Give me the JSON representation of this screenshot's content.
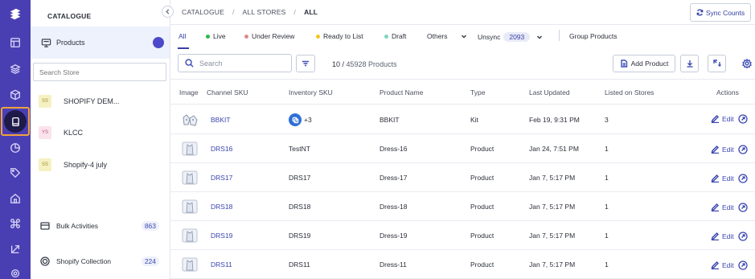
{
  "sidebar_rail": {
    "icons": [
      "logo-icon",
      "dashboard-icon",
      "layers-icon",
      "box-icon",
      "catalogue-icon",
      "analytics-icon",
      "tag-icon",
      "home-icon",
      "command-icon",
      "arrow-icon",
      "settings-icon"
    ],
    "accent": "#4a3fb2",
    "highlight": "#f0a23c"
  },
  "catalogue_panel": {
    "title": "CATALOGUE",
    "products_label": "Products",
    "search_placeholder": "Search Store",
    "stores": [
      {
        "badge": "SS",
        "name": "SHOPIFY DEM...",
        "badge_bg": "#f6f1c2",
        "badge_color": "#9c8f2a"
      },
      {
        "badge": "YS",
        "name": "KLCC",
        "badge_bg": "#fbe3ec",
        "badge_color": "#b25a7c"
      },
      {
        "badge": "SS",
        "name": "Shopify-4 july",
        "badge_bg": "#f6f1c2",
        "badge_color": "#9c8f2a"
      }
    ],
    "bulk_activities": {
      "label": "Bulk Activities",
      "count": "863"
    },
    "shopify_collection": {
      "label": "Shopify Collection",
      "count": "224"
    }
  },
  "breadcrumb": {
    "items": [
      "CATALOGUE",
      "ALL STORES",
      "ALL"
    ],
    "separator": "/"
  },
  "sync_button": "Sync Counts",
  "tabs": {
    "all": "All",
    "live": "Live",
    "under_review": "Under Review",
    "ready_to_list": "Ready to List",
    "draft": "Draft",
    "others": "Others",
    "unsync": "Unsync",
    "unsync_count": "2093",
    "group_products": "Group Products",
    "colors": {
      "live": "#2eb84b",
      "under_review": "#d98b8b",
      "ready_to_list": "#f3c623",
      "draft": "#7dd3c0"
    }
  },
  "toolbar": {
    "search_placeholder": "Search",
    "count_shown": "10",
    "count_total": "45928 Products",
    "add_product": "Add Product"
  },
  "table": {
    "headers": {
      "image": "Image",
      "channel_sku": "Channel SKU",
      "inventory_sku": "Inventory SKU",
      "product_name": "Product Name",
      "type": "Type",
      "last_updated": "Last Updated",
      "listed_on_stores": "Listed on Stores",
      "actions": "Actions"
    },
    "edit_label": "Edit",
    "rows": [
      {
        "channel_sku": "BBKIT",
        "inventory_sku": "+3",
        "product_name": "BBKIT",
        "type": "Kit",
        "last_updated": "Feb 19, 9:31 PM",
        "listed": "3"
      },
      {
        "channel_sku": "DRS16",
        "inventory_sku": "TestNT",
        "product_name": "Dress-16",
        "type": "Product",
        "last_updated": "Jan 24, 7:51 PM",
        "listed": "1"
      },
      {
        "channel_sku": "DRS17",
        "inventory_sku": "DRS17",
        "product_name": "Dress-17",
        "type": "Product",
        "last_updated": "Jan 7, 5:17 PM",
        "listed": "1"
      },
      {
        "channel_sku": "DRS18",
        "inventory_sku": "DRS18",
        "product_name": "Dress-18",
        "type": "Product",
        "last_updated": "Jan 7, 5:17 PM",
        "listed": "1"
      },
      {
        "channel_sku": "DRS19",
        "inventory_sku": "DRS19",
        "product_name": "Dress-19",
        "type": "Product",
        "last_updated": "Jan 7, 5:17 PM",
        "listed": "1"
      },
      {
        "channel_sku": "DRS11",
        "inventory_sku": "DRS11",
        "product_name": "Dress-11",
        "type": "Product",
        "last_updated": "Jan 7, 5:17 PM",
        "listed": "1"
      }
    ]
  }
}
